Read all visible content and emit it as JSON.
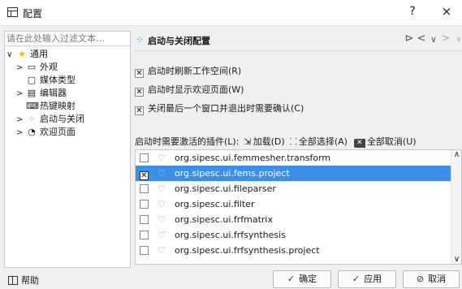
{
  "window": {
    "title": "配置",
    "help_label": "?",
    "close_label": "×"
  },
  "tree": {
    "filter_placeholder": "请在此处输入过滤文本…",
    "items": [
      {
        "label": "通用",
        "arrow": "∨",
        "icon": "★"
      },
      {
        "label": "外观",
        "arrow": ">",
        "icon": "▭"
      },
      {
        "label": "媒体类型",
        "arrow": "",
        "icon": "▢"
      },
      {
        "label": "编辑器",
        "arrow": ">",
        "icon": "▤"
      },
      {
        "label": "热键映射",
        "arrow": "",
        "icon": "⌨"
      },
      {
        "label": "启动与关闭",
        "arrow": ">",
        "icon": "⁘"
      },
      {
        "label": "欢迎页面",
        "arrow": ">",
        "icon": "◔"
      }
    ]
  },
  "page": {
    "title": "启动与关闭配置",
    "nav_menu": "⊳",
    "nav_back": "<",
    "nav_dropdown": "∨",
    "nav_forward": ">"
  },
  "options": [
    {
      "label": "启动时刷新工作空间(R)",
      "checked": true
    },
    {
      "label": "启动时显示欢迎页面(W)",
      "checked": true
    },
    {
      "label": "关闭最后一个窗口并退出时需要确认(C)",
      "checked": true
    }
  ],
  "plugins": {
    "header_label": "启动时需要激活的插件(L):",
    "load_label": "加载(D)",
    "select_all_label": "全部选择(A)",
    "deselect_all_label": "全部取消(U)",
    "items": [
      {
        "name": "org.sipesc.ui.femmesher.transform",
        "checked": false
      },
      {
        "name": "org.sipesc.ui.fems.project",
        "checked": true,
        "selected": true
      },
      {
        "name": "org.sipesc.ui.fileparser",
        "checked": false
      },
      {
        "name": "org.sipesc.ui.filter",
        "checked": false
      },
      {
        "name": "org.sipesc.ui.frfmatrix",
        "checked": false
      },
      {
        "name": "org.sipesc.ui.frfsynthesis",
        "checked": false
      },
      {
        "name": "org.sipesc.ui.frfsynthesis.project",
        "checked": false
      }
    ]
  },
  "buttons": {
    "help": "帮助",
    "ok": "确定",
    "apply": "应用",
    "cancel": "取消"
  },
  "colors": {
    "selection": "#3d8ee8",
    "star": "#f5b400"
  }
}
